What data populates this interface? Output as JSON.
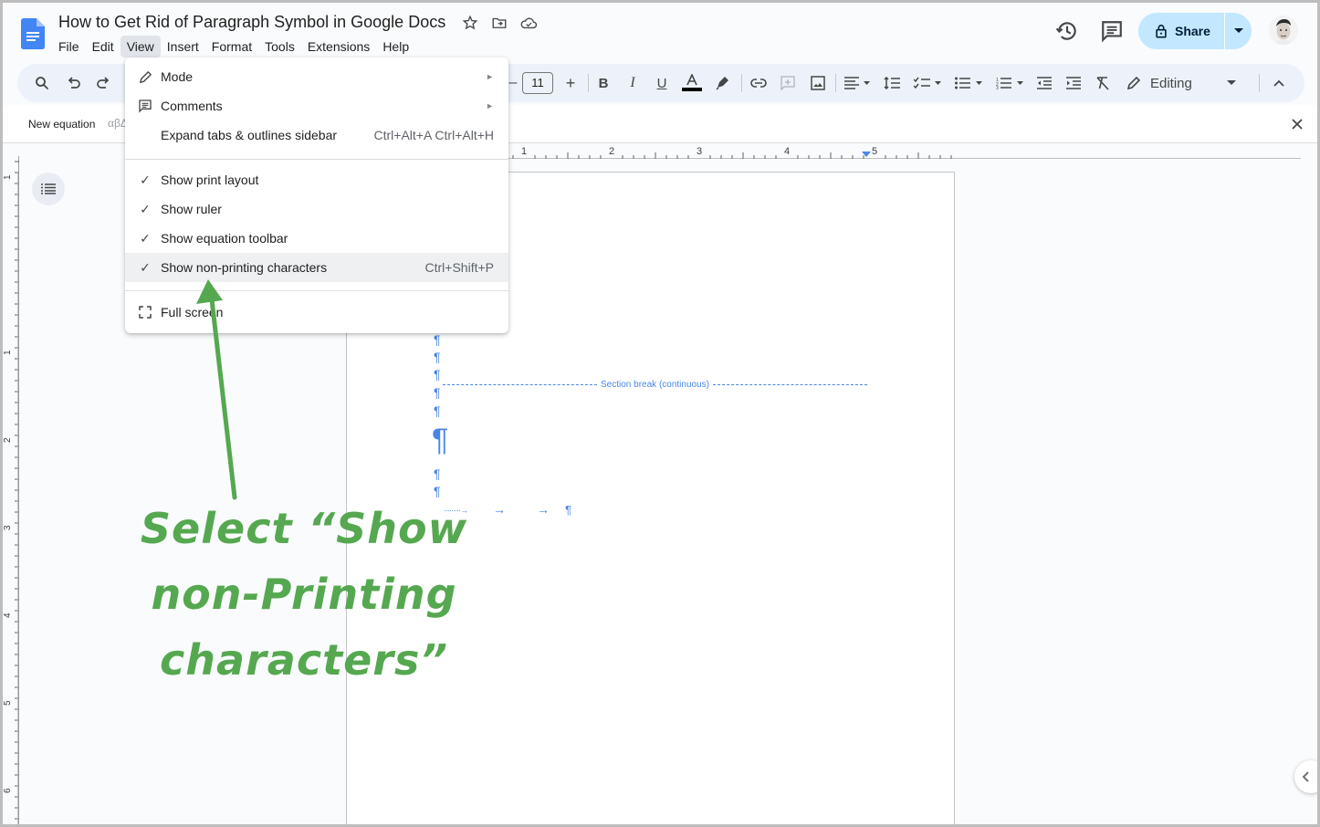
{
  "app": {
    "doc_title": "How to Get Rid of Paragraph Symbol in Google Docs",
    "brand_color": "#4285f4",
    "accent_color": "#c2e7ff",
    "nonprint_color": "#4a86e8",
    "annotation_color": "#55a84f"
  },
  "menubar": {
    "items": [
      {
        "label": "File"
      },
      {
        "label": "Edit"
      },
      {
        "label": "View",
        "active": true
      },
      {
        "label": "Insert"
      },
      {
        "label": "Format"
      },
      {
        "label": "Tools"
      },
      {
        "label": "Extensions"
      },
      {
        "label": "Help"
      }
    ]
  },
  "header": {
    "icons": [
      "star-icon",
      "move-to-folder-icon",
      "cloud-saved-icon",
      "history-icon",
      "comments-icon"
    ],
    "share_label": "Share"
  },
  "toolbar": {
    "font_size": "11",
    "editing_label": "Editing"
  },
  "equation_bar": {
    "new_equation_label": "New equation",
    "greek_label": "αβΔ"
  },
  "view_menu": {
    "items": [
      {
        "label": "Mode",
        "icon": "pencil-icon",
        "submenu": true
      },
      {
        "label": "Comments",
        "icon": "comments-icon",
        "submenu": true
      },
      {
        "label": "Expand tabs & outlines sidebar",
        "shortcut": "Ctrl+Alt+A Ctrl+Alt+H"
      },
      {
        "label": "Show print layout",
        "checked": true
      },
      {
        "label": "Show ruler",
        "checked": true
      },
      {
        "label": "Show equation toolbar",
        "checked": true
      },
      {
        "label": "Show non-printing characters",
        "checked": true,
        "shortcut": "Ctrl+Shift+P",
        "highlighted": true
      },
      {
        "label": "Full screen",
        "icon": "fullscreen-icon"
      }
    ],
    "submenu_arrow": "►",
    "check_glyph": "✓"
  },
  "rulers": {
    "horizontal_labels": [
      "1",
      "2",
      "3",
      "4",
      "5"
    ],
    "vertical_labels": [
      "1",
      "1",
      "2",
      "3",
      "4",
      "5",
      "6"
    ]
  },
  "document": {
    "pilcrow": "¶",
    "section_break_label": "Section break (continuous)",
    "tab_arrow": "→",
    "tab_dotted": "·········→"
  },
  "annotation": {
    "line1": "Select “Show",
    "line2": "non-Printing",
    "line3": "characters”"
  }
}
